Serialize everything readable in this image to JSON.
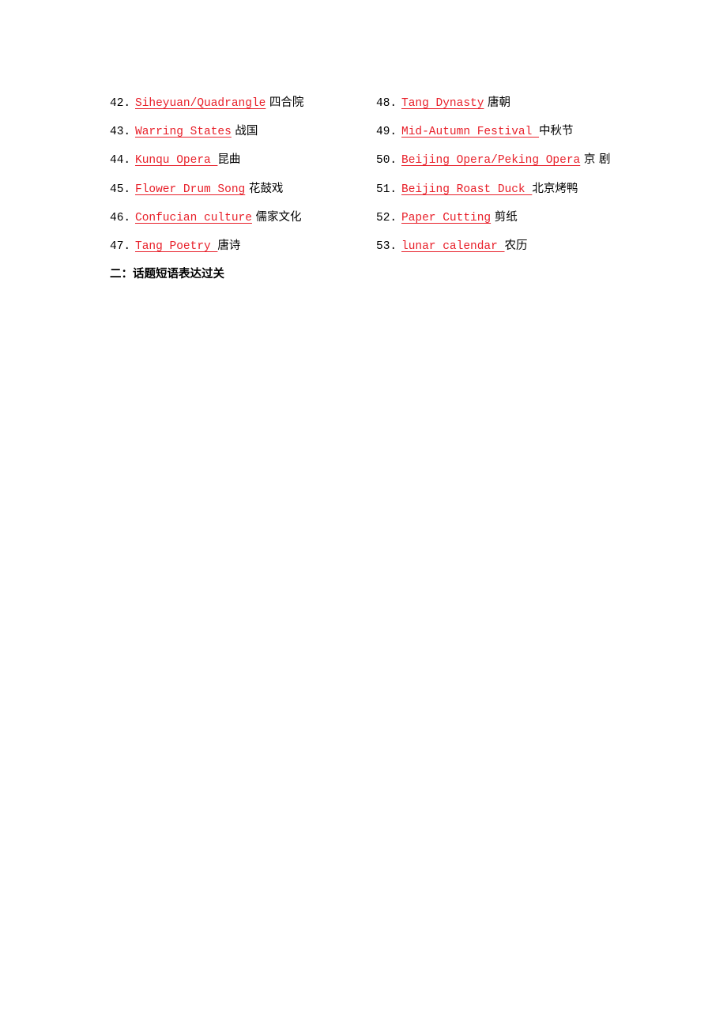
{
  "left_column": [
    {
      "number": "42.",
      "term": "Siheyuan/Quadrangle",
      "term_suffix": "",
      "chinese": " 四合院"
    },
    {
      "number": "43.",
      "term": "Warring States",
      "term_suffix": "",
      "chinese": " 战国"
    },
    {
      "number": "44.",
      "term": "Kunqu Opera ",
      "term_suffix": "",
      "chinese": "昆曲"
    },
    {
      "number": "45.",
      "term": "Flower Drum Song",
      "term_suffix": "",
      "chinese": " 花鼓戏"
    },
    {
      "number": "46.",
      "term": "Confucian culture",
      "term_suffix": "",
      "chinese": " 儒家文化"
    },
    {
      "number": "47.",
      "term": "Tang Poetry ",
      "term_suffix": "",
      "chinese": "唐诗"
    }
  ],
  "right_column": [
    {
      "number": "48.",
      "term": "Tang Dynasty",
      "term_suffix": "",
      "chinese": " 唐朝"
    },
    {
      "number": "49.",
      "term": "Mid-Autumn Festival ",
      "term_suffix": "",
      "chinese": "中秋节"
    },
    {
      "number": "50.",
      "term": "Beijing Opera/Peking Opera",
      "term_suffix": "",
      "chinese": " 京 剧"
    },
    {
      "number": "51.",
      "term": "Beijing Roast Duck ",
      "term_suffix": "",
      "chinese": "北京烤鸭"
    },
    {
      "number": "52.",
      "term": "Paper Cutting",
      "term_suffix": "",
      "chinese": " 剪纸"
    },
    {
      "number": "53.",
      "term": "lunar calendar ",
      "term_suffix": "",
      "chinese": "农历"
    }
  ],
  "section_heading": "二：话题短语表达过关",
  "colors": {
    "term_red": "#e8202a",
    "text": "#000000",
    "background": "#ffffff"
  }
}
